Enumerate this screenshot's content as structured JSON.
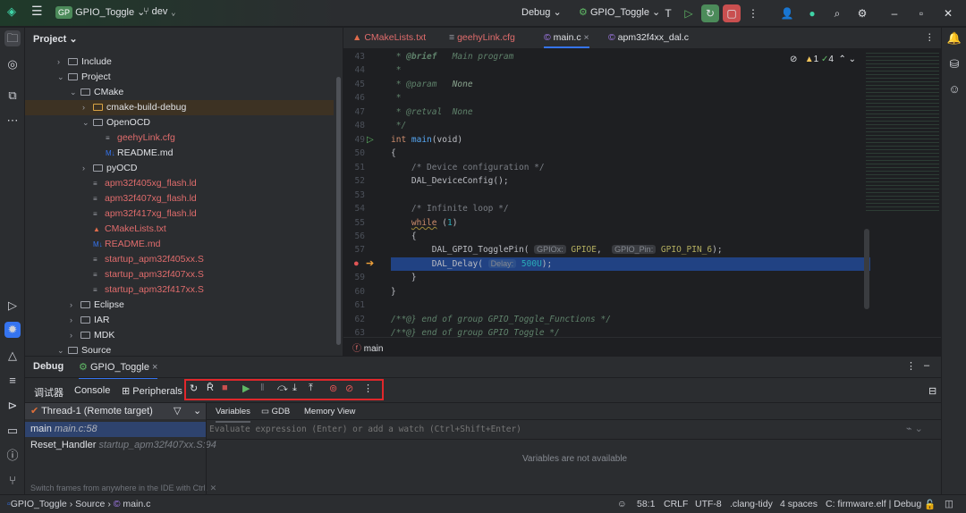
{
  "topbar": {
    "project_badge": "GP",
    "project": "GPIO_Toggle",
    "branch": "dev",
    "config": "Debug",
    "run_target": "GPIO_Toggle"
  },
  "project_panel": {
    "title": "Project",
    "items": [
      {
        "label": "Include",
        "depth": 0,
        "type": "folder",
        "expanded": false
      },
      {
        "label": "Project",
        "depth": 0,
        "type": "folder",
        "expanded": true
      },
      {
        "label": "CMake",
        "depth": 1,
        "type": "folder",
        "expanded": true
      },
      {
        "label": "cmake-build-debug",
        "depth": 2,
        "type": "folder",
        "expanded": false,
        "highlighted": true
      },
      {
        "label": "OpenOCD",
        "depth": 2,
        "type": "folder",
        "expanded": true
      },
      {
        "label": "geehyLink.cfg",
        "depth": 3,
        "type": "file",
        "color": "red"
      },
      {
        "label": "README.md",
        "depth": 3,
        "type": "md"
      },
      {
        "label": "pyOCD",
        "depth": 2,
        "type": "folder",
        "expanded": false
      },
      {
        "label": "apm32f405xg_flash.ld",
        "depth": 2,
        "type": "file",
        "color": "red"
      },
      {
        "label": "apm32f407xg_flash.ld",
        "depth": 2,
        "type": "file",
        "color": "red"
      },
      {
        "label": "apm32f417xg_flash.ld",
        "depth": 2,
        "type": "file",
        "color": "red"
      },
      {
        "label": "CMakeLists.txt",
        "depth": 2,
        "type": "cmake",
        "color": "red"
      },
      {
        "label": "README.md",
        "depth": 2,
        "type": "md",
        "color": "red"
      },
      {
        "label": "startup_apm32f405xx.S",
        "depth": 2,
        "type": "file",
        "color": "red"
      },
      {
        "label": "startup_apm32f407xx.S",
        "depth": 2,
        "type": "file",
        "color": "red"
      },
      {
        "label": "startup_apm32f417xx.S",
        "depth": 2,
        "type": "file",
        "color": "red"
      },
      {
        "label": "Eclipse",
        "depth": 1,
        "type": "folder",
        "expanded": false
      },
      {
        "label": "IAR",
        "depth": 1,
        "type": "folder",
        "expanded": false
      },
      {
        "label": "MDK",
        "depth": 1,
        "type": "folder",
        "expanded": false
      },
      {
        "label": "Source",
        "depth": 0,
        "type": "folder",
        "expanded": true
      }
    ]
  },
  "editor": {
    "tabs": [
      {
        "label": "CMakeLists.txt"
      },
      {
        "label": "geehyLink.cfg"
      },
      {
        "label": "main.c",
        "active": true
      },
      {
        "label": "apm32f4xx_dal.c"
      }
    ],
    "inspections": {
      "warnings": "1",
      "ok": "4"
    },
    "lines": [
      "43",
      "44",
      "45",
      "46",
      "47",
      "48",
      "49",
      "50",
      "51",
      "52",
      "53",
      "54",
      "55",
      "56",
      "57",
      "",
      "59",
      "60",
      "61",
      "62",
      "63"
    ],
    "code": {
      "l43a": " * ",
      "l43b": "@brief",
      "l43c": "   Main program",
      "l44": " *",
      "l45a": " * ",
      "l45b": "@param",
      "l45c": "   None",
      "l46": " *",
      "l47a": " * ",
      "l47b": "@retval",
      "l47c": "  None",
      "l48": " */",
      "l49a": "int ",
      "l49b": "main",
      "l49c": "(void)",
      "l50": "{",
      "l51": "    /* Device configuration */",
      "l52": "    DAL_DeviceConfig();",
      "l54": "    /* Infinite loop */",
      "l55a": "    ",
      "l55b": "while",
      "l55c": " (",
      "l55d": "1",
      "l55e": ")",
      "l56": "    {",
      "l57a": "        DAL_GPIO_TogglePin( ",
      "l57h1": "GPIOx:",
      "l57b": " GPIOE",
      "l57c": ",  ",
      "l57h2": "GPIO_Pin:",
      "l57d": " GPIO_PIN_6",
      "l57e": ");",
      "l58a": "        DAL_Delay( ",
      "l58h": "Delay:",
      "l58b": " 500U",
      "l58c": ");",
      "l59": "    }",
      "l60": "}",
      "l62": "/**@} end of group GPIO_Toggle_Functions */",
      "l63": "/**@} end of group GPIO_Toggle */"
    },
    "breadcrumb": "main"
  },
  "debug": {
    "title": "Debug",
    "session": "GPIO_Toggle",
    "tabs": [
      "调试器",
      "Console",
      "Peripherals"
    ],
    "thread": "Thread-1 (Remote target)",
    "frames": [
      {
        "name": "main",
        "loc": "main.c:58",
        "selected": true
      },
      {
        "name": "Reset_Handler",
        "loc": "startup_apm32f407xx.S:94"
      }
    ],
    "frames_hint": "Switch frames from anywhere in the IDE with Ctrl.",
    "var_tabs": [
      "Variables",
      "GDB",
      "Memory View"
    ],
    "eval_placeholder": "Evaluate expression (Enter) or add a watch (Ctrl+Shift+Enter)",
    "empty": "Variables are not available",
    "toolbar_highlight": "#e0272b"
  },
  "statusbar": {
    "crumbs": [
      "GPIO_Toggle",
      "Source",
      "main.c"
    ],
    "position": "58:1",
    "line_sep": "CRLF",
    "encoding": "UTF-8",
    "linter": ".clang-tidy",
    "indent": "4 spaces",
    "context": "C: firmware.elf | Debug"
  }
}
